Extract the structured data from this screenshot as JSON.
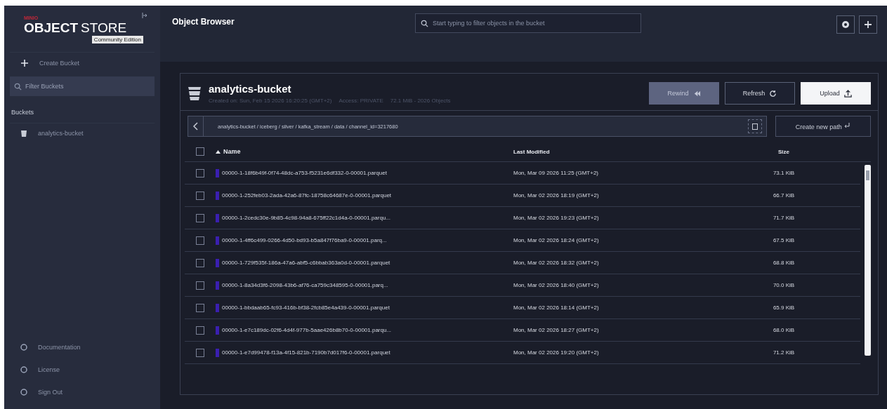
{
  "brand": {
    "vendor": "MINIO",
    "product_bold": "OBJECT",
    "product_light": "STORE",
    "edition": "Community Edition"
  },
  "sidebar": {
    "create": "Create Bucket",
    "filter_placeholder": "Filter Buckets",
    "section": "Buckets",
    "buckets": [
      {
        "name": "analytics-bucket",
        "selected": false
      }
    ],
    "footer": [
      "Documentation",
      "License",
      "Sign Out"
    ]
  },
  "header": {
    "title": "Object Browser",
    "search_placeholder": "Start typing to filter objects in the bucket"
  },
  "bucket": {
    "name": "analytics-bucket",
    "created": "Created on: Sun, Feb 15 2026 16:20:25 (GMT+2)",
    "access": "Access: PRIVATE",
    "usage": "72.1 MiB - 2026 Objects",
    "buttons": [
      {
        "label": "Rewind",
        "kind": "rewind",
        "disabled": true
      },
      {
        "label": "Refresh",
        "kind": "refresh",
        "disabled": false
      },
      {
        "label": "Upload",
        "kind": "upload",
        "disabled": false
      }
    ],
    "path": "analytics-bucket / iceberg / silver / kafka_stream / data / channel_id=3217680",
    "create_path": "Create new path"
  },
  "table": {
    "select_all": false,
    "columns": [
      "Name",
      "Last Modified",
      "Size"
    ],
    "rows": [
      {
        "name": "00000-1-18f6b49f-0f74-48dc-a753-f5231e6df332-0-00001.parquet",
        "modified": "Mon, Mar 09 2026 11:25 (GMT+2)",
        "size": "73.1 KiB",
        "checked": false
      },
      {
        "name": "00000-1-252feb03-2ada-42a6-87fc-18758c64687e-0-00001.parquet",
        "modified": "Mon, Mar 02 2026 18:19 (GMT+2)",
        "size": "66.7 KiB",
        "checked": false
      },
      {
        "name": "00000-1-2cedc30e-9b85-4c98-94a8-675ff22c1d4a-0-00001.parqu...",
        "modified": "Mon, Mar 02 2026 19:23 (GMT+2)",
        "size": "71.7 KiB",
        "checked": false
      },
      {
        "name": "00000-1-4ff6c499-0266-4d50-bd93-b5a847f76ba9-0-00001.parq...",
        "modified": "Mon, Mar 02 2026 18:24 (GMT+2)",
        "size": "67.5 KiB",
        "checked": false
      },
      {
        "name": "00000-1-729f535f-186a-47a6-abf5-c6bbab363a0d-0-00001.parquet",
        "modified": "Mon, Mar 02 2026 18:32 (GMT+2)",
        "size": "68.8 KiB",
        "checked": false
      },
      {
        "name": "00000-1-8a34d3f6-2098-43b6-af76-ca759c348595-0-00001.parq...",
        "modified": "Mon, Mar 02 2026 18:40 (GMT+2)",
        "size": "70.0 KiB",
        "checked": false
      },
      {
        "name": "00000-1-bbdaab65-fc93-416b-bf38-2fcb85e4a439-0-00001.parquet",
        "modified": "Mon, Mar 02 2026 18:14 (GMT+2)",
        "size": "65.9 KiB",
        "checked": false
      },
      {
        "name": "00000-1-e7c189dc-02f6-4d4f-977b-5aae426b8b70-0-00001.parqu...",
        "modified": "Mon, Mar 02 2026 18:27 (GMT+2)",
        "size": "68.0 KiB",
        "checked": false
      },
      {
        "name": "00000-1-e7d99478-f13a-4f15-821b-7190b7d017f6-0-00001.parquet",
        "modified": "Mon, Mar 02 2026 19:20 (GMT+2)",
        "size": "71.2 KiB",
        "checked": false
      }
    ]
  }
}
